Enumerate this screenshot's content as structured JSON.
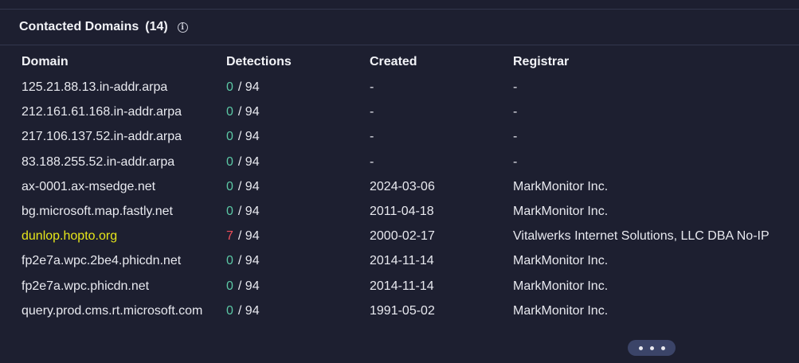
{
  "section": {
    "title": "Contacted Domains",
    "count": "(14)",
    "info_icon": "info-icon"
  },
  "table": {
    "columns": [
      "Domain",
      "Detections",
      "Created",
      "Registrar"
    ],
    "rows": [
      {
        "domain": "125.21.88.13.in-addr.arpa",
        "detections": "0",
        "total": "/ 94",
        "created": "-",
        "registrar": "-"
      },
      {
        "domain": "212.161.61.168.in-addr.arpa",
        "detections": "0",
        "total": "/ 94",
        "created": "-",
        "registrar": "-"
      },
      {
        "domain": "217.106.137.52.in-addr.arpa",
        "detections": "0",
        "total": "/ 94",
        "created": "-",
        "registrar": "-"
      },
      {
        "domain": "83.188.255.52.in-addr.arpa",
        "detections": "0",
        "total": "/ 94",
        "created": "-",
        "registrar": "-"
      },
      {
        "domain": "ax-0001.ax-msedge.net",
        "detections": "0",
        "total": "/ 94",
        "created": "2024-03-06",
        "registrar": "MarkMonitor Inc."
      },
      {
        "domain": "bg.microsoft.map.fastly.net",
        "detections": "0",
        "total": "/ 94",
        "created": "2011-04-18",
        "registrar": "MarkMonitor Inc."
      },
      {
        "domain": "dunlop.hopto.org",
        "detections": "7",
        "total": "/ 94",
        "created": "2000-02-17",
        "registrar": "Vitalwerks Internet Solutions, LLC DBA No-IP"
      },
      {
        "domain": "fp2e7a.wpc.2be4.phicdn.net",
        "detections": "0",
        "total": "/ 94",
        "created": "2014-11-14",
        "registrar": "MarkMonitor Inc."
      },
      {
        "domain": "fp2e7a.wpc.phicdn.net",
        "detections": "0",
        "total": "/ 94",
        "created": "2014-11-14",
        "registrar": "MarkMonitor Inc."
      },
      {
        "domain": "query.prod.cms.rt.microsoft.com",
        "detections": "0",
        "total": "/ 94",
        "created": "1991-05-02",
        "registrar": "MarkMonitor Inc."
      }
    ]
  },
  "more_button": {
    "icon": "more-horizontal-icon"
  },
  "colors": {
    "background": "#1d1f30",
    "clean_detection": "#5bc7a4",
    "malicious_detection": "#f0505a",
    "highlight_domain": "#e6e61a"
  }
}
